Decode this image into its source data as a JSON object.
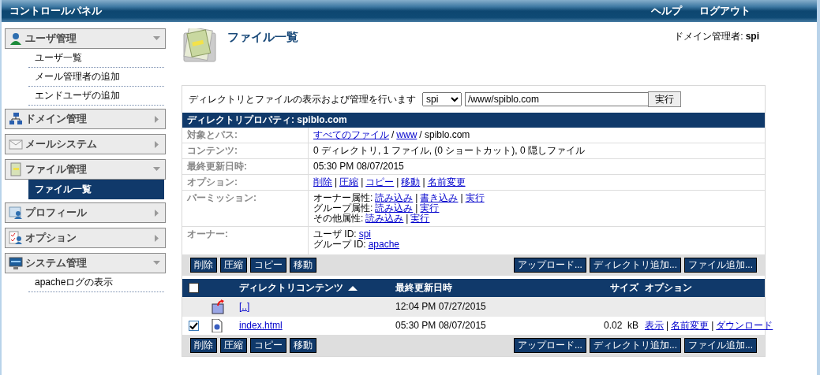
{
  "header": {
    "title": "コントロールパネル",
    "links": [
      "ヘルプ",
      "ログアウト"
    ]
  },
  "sidebar": {
    "sections": [
      {
        "label": "ユーザ管理",
        "expanded": true,
        "items": [
          {
            "label": "ユーザ一覧",
            "selected": false
          },
          {
            "label": "メール管理者の追加",
            "selected": false
          },
          {
            "label": "エンドユーザの追加",
            "selected": false
          }
        ]
      },
      {
        "label": "ドメイン管理",
        "expanded": false
      },
      {
        "label": "メールシステム",
        "expanded": false
      },
      {
        "label": "ファイル管理",
        "expanded": true,
        "items": [
          {
            "label": "ファイル一覧",
            "selected": true
          }
        ]
      },
      {
        "label": "プロフィール",
        "expanded": false
      },
      {
        "label": "オプション",
        "expanded": false
      },
      {
        "label": "システム管理",
        "expanded": true,
        "items": [
          {
            "label": "apacheログの表示",
            "selected": false
          }
        ]
      }
    ]
  },
  "page": {
    "title": "ファイル一覧",
    "admin_label": "ドメイン管理者:",
    "admin_name": "spi"
  },
  "browser": {
    "prompt": "ディレクトリとファイルの表示および管理を行います",
    "user_select": "spi",
    "path": "/www/spiblo.com",
    "go_button": "実行"
  },
  "properties": {
    "title": "ディレクトリプロパティ: spiblo.com",
    "rows": [
      {
        "label": "対象とパス:",
        "lines": [
          [
            {
              "kind": "link",
              "text": "すべてのファイル"
            },
            {
              "kind": "text",
              "text": "/"
            },
            {
              "kind": "link",
              "text": "www"
            },
            {
              "kind": "text",
              "text": "/ spiblo.com"
            }
          ]
        ]
      },
      {
        "label": "コンテンツ:",
        "lines": [
          [
            {
              "kind": "text",
              "text": "0 ディレクトリ, 1 ファイル, (0 ショートカット), 0 隠しファイル"
            }
          ]
        ]
      },
      {
        "label": "最終更新日時:",
        "lines": [
          [
            {
              "kind": "text",
              "text": "05:30 PM 08/07/2015"
            }
          ]
        ]
      },
      {
        "label": "オプション:",
        "lines": [
          [
            {
              "kind": "link",
              "text": "削除"
            },
            {
              "kind": "text",
              "text": "|"
            },
            {
              "kind": "link",
              "text": "圧縮"
            },
            {
              "kind": "text",
              "text": "|"
            },
            {
              "kind": "link",
              "text": "コピー"
            },
            {
              "kind": "text",
              "text": "|"
            },
            {
              "kind": "link",
              "text": "移動"
            },
            {
              "kind": "text",
              "text": "|"
            },
            {
              "kind": "link",
              "text": "名前変更"
            }
          ]
        ]
      },
      {
        "label": "パーミッション:",
        "lines": [
          [
            {
              "kind": "text",
              "text": "オーナー属性:"
            },
            {
              "kind": "link",
              "text": "読み込み"
            },
            {
              "kind": "text",
              "text": "|"
            },
            {
              "kind": "link",
              "text": "書き込み"
            },
            {
              "kind": "text",
              "text": "|"
            },
            {
              "kind": "link",
              "text": "実行"
            }
          ],
          [
            {
              "kind": "text",
              "text": "グループ属性:"
            },
            {
              "kind": "link",
              "text": "読み込み"
            },
            {
              "kind": "text",
              "text": "|"
            },
            {
              "kind": "link",
              "text": "実行"
            }
          ],
          [
            {
              "kind": "text",
              "text": "その他属性:"
            },
            {
              "kind": "link",
              "text": "読み込み"
            },
            {
              "kind": "text",
              "text": "|"
            },
            {
              "kind": "link",
              "text": "実行"
            }
          ]
        ]
      },
      {
        "label": "オーナー:",
        "lines": [
          [
            {
              "kind": "text",
              "text": "ユーザ ID:"
            },
            {
              "kind": "link",
              "text": "spi"
            }
          ],
          [
            {
              "kind": "text",
              "text": "グループ ID:"
            },
            {
              "kind": "link",
              "text": "apache"
            }
          ]
        ]
      }
    ]
  },
  "toolbar": {
    "left": [
      "削除",
      "圧縮",
      "コピー",
      "移動"
    ],
    "right": [
      "アップロード...",
      "ディレクトリ追加...",
      "ファイル追加..."
    ]
  },
  "files": {
    "select_all": {
      "checked": false
    },
    "columns": [
      {
        "label": "ディレクトリコンテンツ",
        "sorted": true
      },
      {
        "label": "最終更新日時"
      },
      {
        "label": "サイズ"
      },
      {
        "label": "オプション"
      }
    ],
    "rows": [
      {
        "kind": "parent",
        "name": "[..]",
        "modified": "12:04 PM 07/27/2015"
      },
      {
        "kind": "file",
        "checked": true,
        "name": "index.html",
        "modified": "05:30 PM 08/07/2015",
        "size": "0.02  kB",
        "options": [
          {
            "kind": "link",
            "text": "表示"
          },
          {
            "kind": "text",
            "text": "|"
          },
          {
            "kind": "link",
            "text": "名前変更"
          },
          {
            "kind": "text",
            "text": "|"
          },
          {
            "kind": "link",
            "text": "ダウンロード"
          }
        ]
      }
    ]
  },
  "toolbar_bottom": {
    "left": [
      "削除",
      "圧縮",
      "コピー",
      "移動"
    ],
    "right": [
      "アップロード...",
      "ディレクトリ追加...",
      "ファイル追加..."
    ]
  }
}
